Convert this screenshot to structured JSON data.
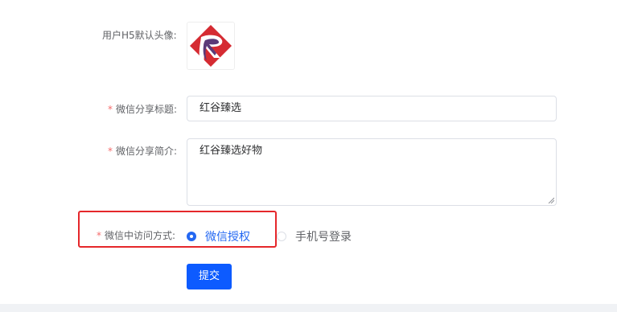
{
  "form": {
    "avatar_label": "用户H5默认头像:",
    "share_title_label": "微信分享标题:",
    "share_title_value": "红谷臻选",
    "share_desc_label": "微信分享简介:",
    "share_desc_value": "红谷臻选好物",
    "access_label": "微信中访问方式:",
    "required_mark": "*",
    "access_options": [
      {
        "label": "微信授权",
        "checked": true
      },
      {
        "label": "手机号登录",
        "checked": false
      }
    ],
    "submit_label": "提交"
  },
  "colors": {
    "primary": "#2468f2",
    "button": "#0d5bff",
    "required": "#f56c6c",
    "highlight": "#e5272b",
    "logo_red": "#d52b32",
    "logo_purple": "#5b3a78"
  },
  "icons": {
    "avatar": "brand-logo-r-icon"
  }
}
